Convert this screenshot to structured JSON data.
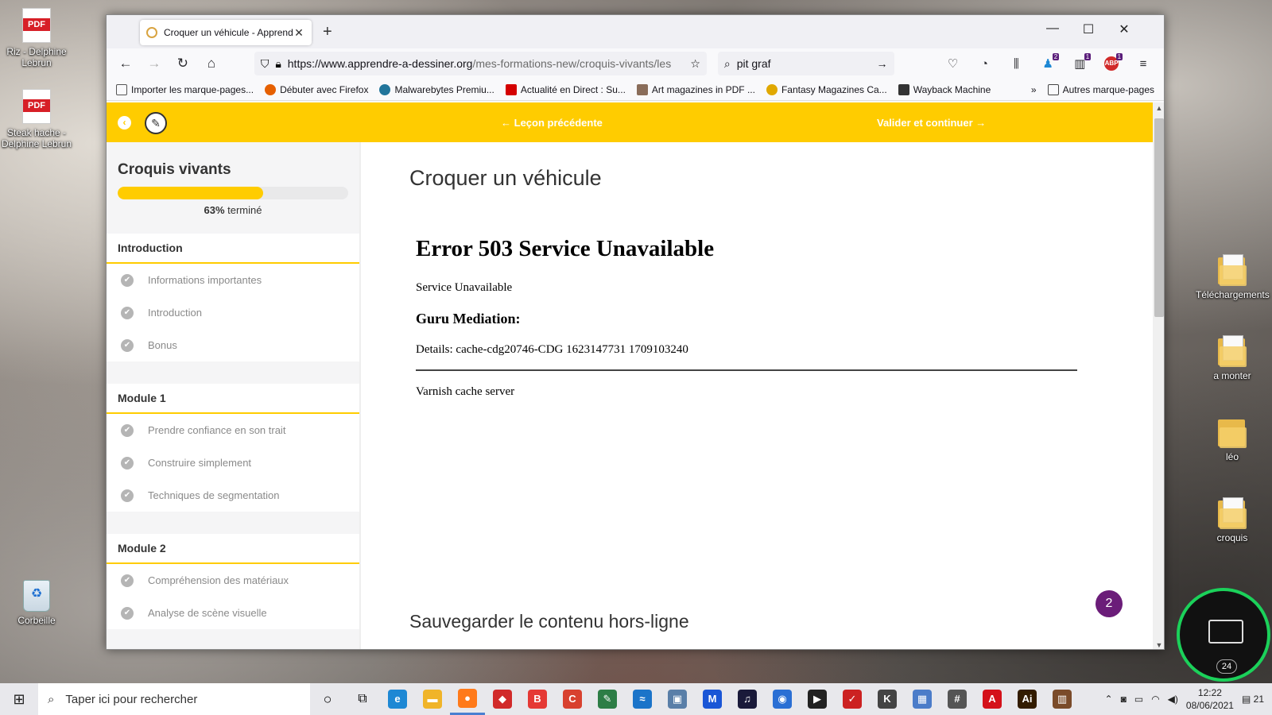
{
  "desktop": {
    "left_icons": [
      {
        "label": "Riz - Delphine Lebrun",
        "badge": "PDF"
      },
      {
        "label": "Steak hache - Delphine Lebrun",
        "badge": "PDF"
      },
      {
        "label": "Corbeille"
      }
    ],
    "right_icons": [
      {
        "label": "Téléchargements"
      },
      {
        "label": "a monter"
      },
      {
        "label": "léo"
      },
      {
        "label": "croquis"
      }
    ],
    "widget_number": "24"
  },
  "browser": {
    "tab_title": "Croquer un véhicule - Apprendre",
    "url_domain": "https://www.apprendre-a-dessiner.org",
    "url_path": "/mes-formations-new/croquis-vivants/les",
    "search_text": "pit graf",
    "badges": {
      "ext1": "2",
      "ext2": "1",
      "abp": "1"
    },
    "bookmarks": [
      {
        "label": "Importer les marque-pages...",
        "color": "#555555"
      },
      {
        "label": "Débuter avec Firefox",
        "color": "#e66000"
      },
      {
        "label": "Malwarebytes Premiu...",
        "color": "#21759b"
      },
      {
        "label": "Actualité en Direct : Su...",
        "color": "#d40000"
      },
      {
        "label": "Art magazines in PDF ...",
        "color": "#8a6d5a"
      },
      {
        "label": "Fantasy Magazines Ca...",
        "color": "#e0a800"
      },
      {
        "label": "Wayback Machine",
        "color": "#333333"
      }
    ],
    "other_bookmarks": "Autres marque-pages"
  },
  "page": {
    "prev_label": "Leçon précédente",
    "next_label": "Valider et continuer",
    "course_title": "Croquis vivants",
    "progress_percent": 63,
    "progress_pct_text": "63%",
    "progress_suffix": "terminé",
    "sections": [
      {
        "title": "Introduction",
        "lessons": [
          "Informations importantes",
          "Introduction",
          "Bonus"
        ]
      },
      {
        "title": "Module 1",
        "lessons": [
          "Prendre confiance en son trait",
          "Construire simplement",
          "Techniques de segmentation"
        ]
      },
      {
        "title": "Module 2",
        "lessons": [
          "Compréhension des matériaux",
          "Analyse de scène visuelle"
        ]
      }
    ],
    "lesson_title": "Croquer un véhicule",
    "error": {
      "heading": "Error 503 Service Unavailable",
      "message": "Service Unavailable",
      "subheading": "Guru Mediation:",
      "details": "Details: cache-cdg20746-CDG 1623147731 1709103240",
      "footer": "Varnish cache server"
    },
    "offline_title": "Sauvegarder le contenu hors-ligne",
    "chat_badge": "2"
  },
  "taskbar": {
    "search_placeholder": "Taper ici pour rechercher",
    "apps": [
      {
        "name": "edge",
        "color": "#1e88d4",
        "glyph": "e"
      },
      {
        "name": "explorer",
        "color": "#f0b429",
        "glyph": "▬"
      },
      {
        "name": "firefox",
        "color": "#ff7a1a",
        "glyph": "●"
      },
      {
        "name": "security",
        "color": "#d12a2a",
        "glyph": "◆"
      },
      {
        "name": "brave-b",
        "color": "#e53935",
        "glyph": "B"
      },
      {
        "name": "ccleaner",
        "color": "#d8412f",
        "glyph": "C"
      },
      {
        "name": "feather",
        "color": "#2d7d46",
        "glyph": "✎"
      },
      {
        "name": "bluetooth-app",
        "color": "#1b74c9",
        "glyph": "≈"
      },
      {
        "name": "image-app",
        "color": "#5a7fa8",
        "glyph": "▣"
      },
      {
        "name": "malwarebytes",
        "color": "#1a56d6",
        "glyph": "M"
      },
      {
        "name": "amazon-music",
        "color": "#1a1a3a",
        "glyph": "♫"
      },
      {
        "name": "webcam-app",
        "color": "#2a6fd4",
        "glyph": "◉"
      },
      {
        "name": "player",
        "color": "#222222",
        "glyph": "▶"
      },
      {
        "name": "ccleaner-red",
        "color": "#cc2222",
        "glyph": "✓"
      },
      {
        "name": "k-app",
        "color": "#444444",
        "glyph": "K"
      },
      {
        "name": "photos",
        "color": "#4b7cc9",
        "glyph": "▦"
      },
      {
        "name": "calculator",
        "color": "#555555",
        "glyph": "#"
      },
      {
        "name": "acrobat",
        "color": "#d4111a",
        "glyph": "A"
      },
      {
        "name": "illustrator",
        "color": "#331c00",
        "glyph": "Ai"
      },
      {
        "name": "library",
        "color": "#7a4b2a",
        "glyph": "▥"
      }
    ],
    "time": "12:22",
    "date": "08/06/2021",
    "notifications": "21"
  }
}
